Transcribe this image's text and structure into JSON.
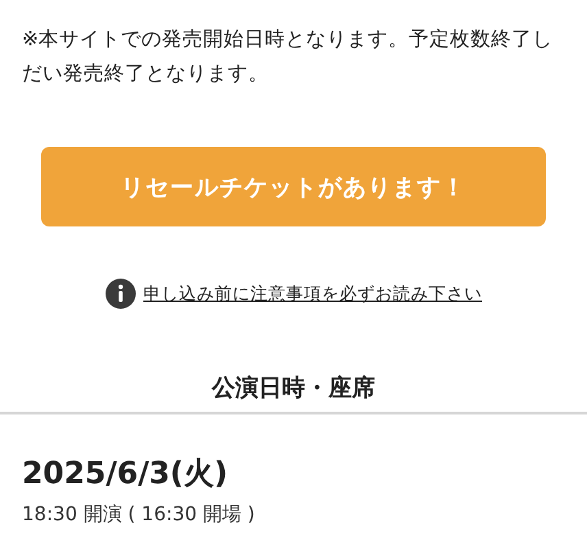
{
  "notice": "※本サイトでの発売開始日時となります。予定枚数終了しだい発売終了となります。",
  "resale_button": {
    "label": "リセールチケットがあります！"
  },
  "caution_link": {
    "label": "申し込み前に注意事項を必ずお読み下さい"
  },
  "section": {
    "title": "公演日時・座席"
  },
  "performance": {
    "date": "2025/6/3(火)",
    "time": "18:30 開演 ( 16:30 開場 )"
  }
}
